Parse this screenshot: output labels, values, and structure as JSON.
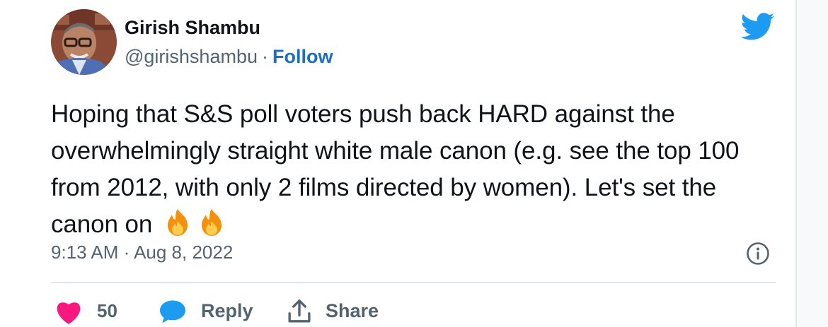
{
  "author": {
    "name": "Girish Shambu",
    "handle": "@girishshambu",
    "separator": "·",
    "follow_label": "Follow"
  },
  "tweet": {
    "text": "Hoping that S&S poll voters push back HARD against the overwhelmingly straight white male canon (e.g. see the top 100 from 2012, with only 2 films directed by women). Let's set the canon on",
    "emojis": [
      "fire-emoji",
      "fire-emoji"
    ],
    "timestamp": "9:13 AM · Aug 8, 2022"
  },
  "actions": {
    "like_count": "50",
    "reply_label": "Reply",
    "share_label": "Share"
  },
  "colors": {
    "brand_blue": "#1d9bf0",
    "follow_blue": "#1d6fc4",
    "heart_pink": "#f91880",
    "secondary_text": "#536471"
  },
  "icons": [
    "twitter-bird-icon",
    "info-icon",
    "heart-icon",
    "reply-bubble-icon",
    "share-icon"
  ]
}
